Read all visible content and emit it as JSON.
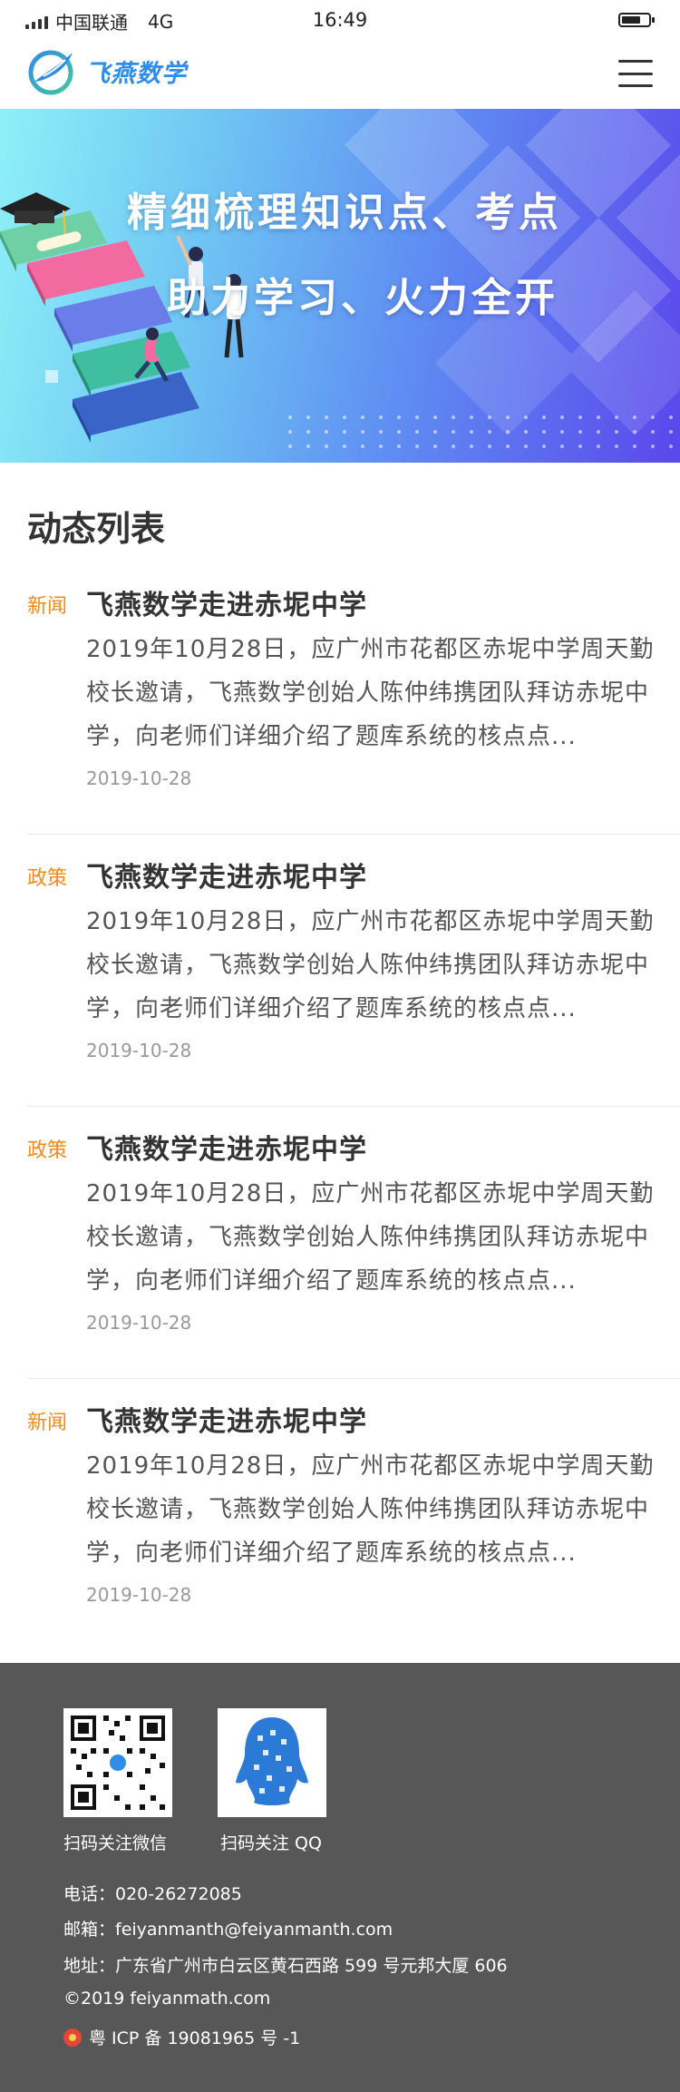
{
  "status_bar": {
    "carrier": "中国联通",
    "network": "4G",
    "time": "16:49"
  },
  "header": {
    "logo_text": "飞燕数学",
    "menu_icon": "hamburger-menu-icon"
  },
  "banner": {
    "line1": "精细梳理知识点、考点",
    "line2": "助力学习、火力全开"
  },
  "section": {
    "title": "动态列表"
  },
  "news": [
    {
      "tag": "新闻",
      "title": "飞燕数学走进赤坭中学",
      "summary": "2019年10月28日，应广州市花都区赤坭中学周天勤校长邀请，飞燕数学创始人陈仲纬携团队拜访赤坭中学，向老师们详细介绍了题库系统的核点点...",
      "date": "2019-10-28"
    },
    {
      "tag": "政策",
      "title": "飞燕数学走进赤坭中学",
      "summary": "2019年10月28日，应广州市花都区赤坭中学周天勤校长邀请，飞燕数学创始人陈仲纬携团队拜访赤坭中学，向老师们详细介绍了题库系统的核点点...",
      "date": "2019-10-28"
    },
    {
      "tag": "政策",
      "title": "飞燕数学走进赤坭中学",
      "summary": "2019年10月28日，应广州市花都区赤坭中学周天勤校长邀请，飞燕数学创始人陈仲纬携团队拜访赤坭中学，向老师们详细介绍了题库系统的核点点...",
      "date": "2019-10-28"
    },
    {
      "tag": "新闻",
      "title": "飞燕数学走进赤坭中学",
      "summary": "2019年10月28日，应广州市花都区赤坭中学周天勤校长邀请，飞燕数学创始人陈仲纬携团队拜访赤坭中学，向老师们详细介绍了题库系统的核点点...",
      "date": "2019-10-28"
    }
  ],
  "footer": {
    "wechat_caption": "扫码关注微信",
    "qq_caption": "扫码关注 QQ",
    "phone": "电话：020-26272085",
    "email": "邮箱：feiyanmanth@feiyanmanth.com",
    "address": "地址：广东省广州市白云区黄石西路 599 号元邦大厦 606",
    "copyright": "©2019 feiyanmath.com",
    "icp": "粤 ICP 备 19081965 号 -1"
  },
  "colors": {
    "accent": "#2f8de8",
    "tag": "#f28a1c",
    "footer_bg": "#575757"
  }
}
